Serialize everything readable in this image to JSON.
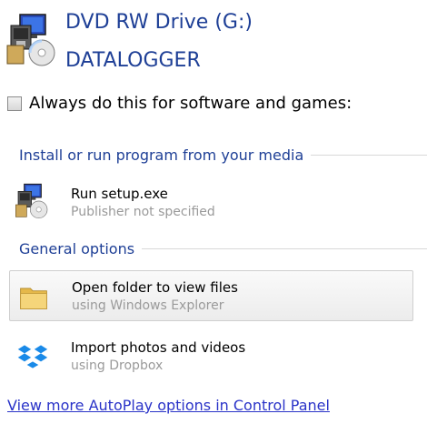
{
  "header": {
    "drive_name": "DVD RW Drive (G:)",
    "volume_label": "DATALOGGER",
    "icon": "setup-program-icon"
  },
  "always_checkbox": {
    "label": "Always do this for software and games:",
    "checked": false
  },
  "sections": [
    {
      "title": "Install or run program from your media",
      "options": [
        {
          "main": "Run setup.exe",
          "sub": "Publisher not specified",
          "icon": "setup-program-icon"
        }
      ]
    },
    {
      "title": "General options",
      "options": [
        {
          "main": "Open folder to view files",
          "sub": "using Windows Explorer",
          "icon": "folder-icon",
          "highlighted": true
        },
        {
          "main": "Import photos and videos",
          "sub": "using Dropbox",
          "icon": "dropbox-icon"
        }
      ]
    }
  ],
  "footer_link": "View more AutoPlay options in Control Panel",
  "colors": {
    "title_blue": "#1e3f96",
    "link_blue": "#2a33c8",
    "subtext_gray": "#9a9a9a",
    "dropbox_blue": "#1a8ae8",
    "folder_yellow": "#f2c94c"
  }
}
